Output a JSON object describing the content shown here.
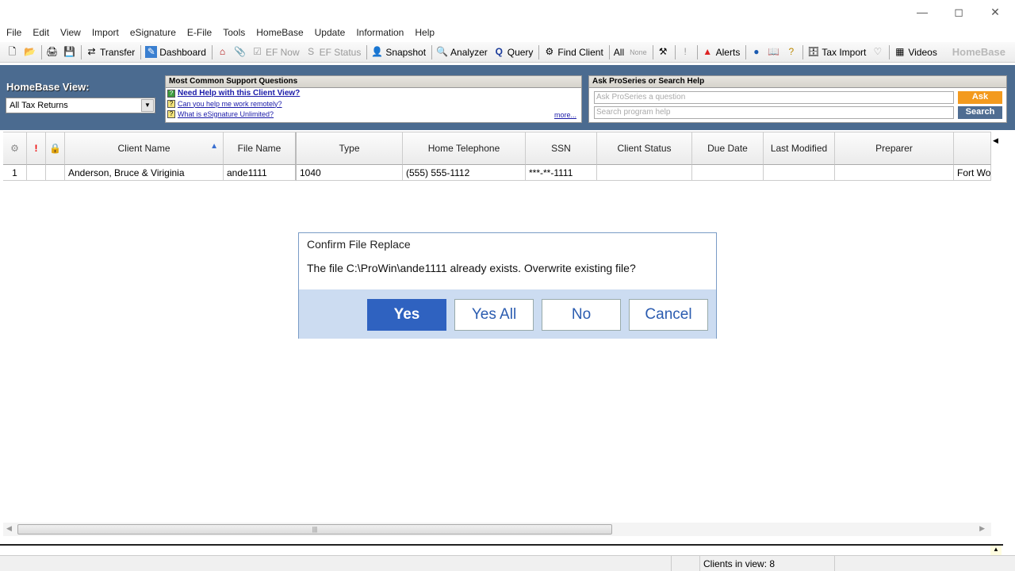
{
  "menu": [
    "File",
    "Edit",
    "View",
    "Import",
    "eSignature",
    "E-File",
    "Tools",
    "HomeBase",
    "Update",
    "Information",
    "Help"
  ],
  "toolbar": {
    "transfer": "Transfer",
    "dashboard": "Dashboard",
    "ef_now": "EF Now",
    "ef_status": "EF Status",
    "snapshot": "Snapshot",
    "analyzer": "Analyzer",
    "query": "Query",
    "find_client": "Find Client",
    "all": "All",
    "none": "None",
    "alerts": "Alerts",
    "tax_import": "Tax Import",
    "videos": "Videos",
    "brand": "HomeBase"
  },
  "homebase_view": {
    "label": "HomeBase View:",
    "value": "All Tax Returns"
  },
  "support": {
    "title": "Most Common Support Questions",
    "questions": [
      "Need Help with this Client View?",
      "Can you help me work remotely?",
      "What is eSignature Unlimited?"
    ],
    "more": "more..."
  },
  "ask": {
    "title": "Ask ProSeries or Search Help",
    "ask_placeholder": "Ask ProSeries a question",
    "search_placeholder": "Search program help",
    "ask_button": "Ask",
    "search_button": "Search"
  },
  "table": {
    "columns": [
      "Client Name",
      "File Name",
      "Type",
      "Home Telephone",
      "SSN",
      "Client Status",
      "Due Date",
      "Last Modified",
      "Preparer"
    ],
    "rows": [
      {
        "num": "1",
        "client_name": "Anderson, Bruce & Viriginia",
        "file_name": "ande1111",
        "type": "1040",
        "home_telephone": "(555) 555-1112",
        "ssn": "***-**-1111",
        "client_status": "",
        "due_date": "",
        "last_modified": "",
        "preparer": "",
        "extra": "Fort Wo"
      }
    ]
  },
  "dialog": {
    "title": "Confirm File Replace",
    "message": "The file C:\\ProWin\\ande1111 already exists.  Overwrite existing file?",
    "buttons": [
      "Yes",
      "Yes All",
      "No",
      "Cancel"
    ]
  },
  "status": {
    "clients_in_view": "Clients in view: 8"
  },
  "colors": {
    "panel": "#4b6b90",
    "ask": "#f39a1e",
    "search": "#4f6d92",
    "primary": "#2f62c0"
  }
}
